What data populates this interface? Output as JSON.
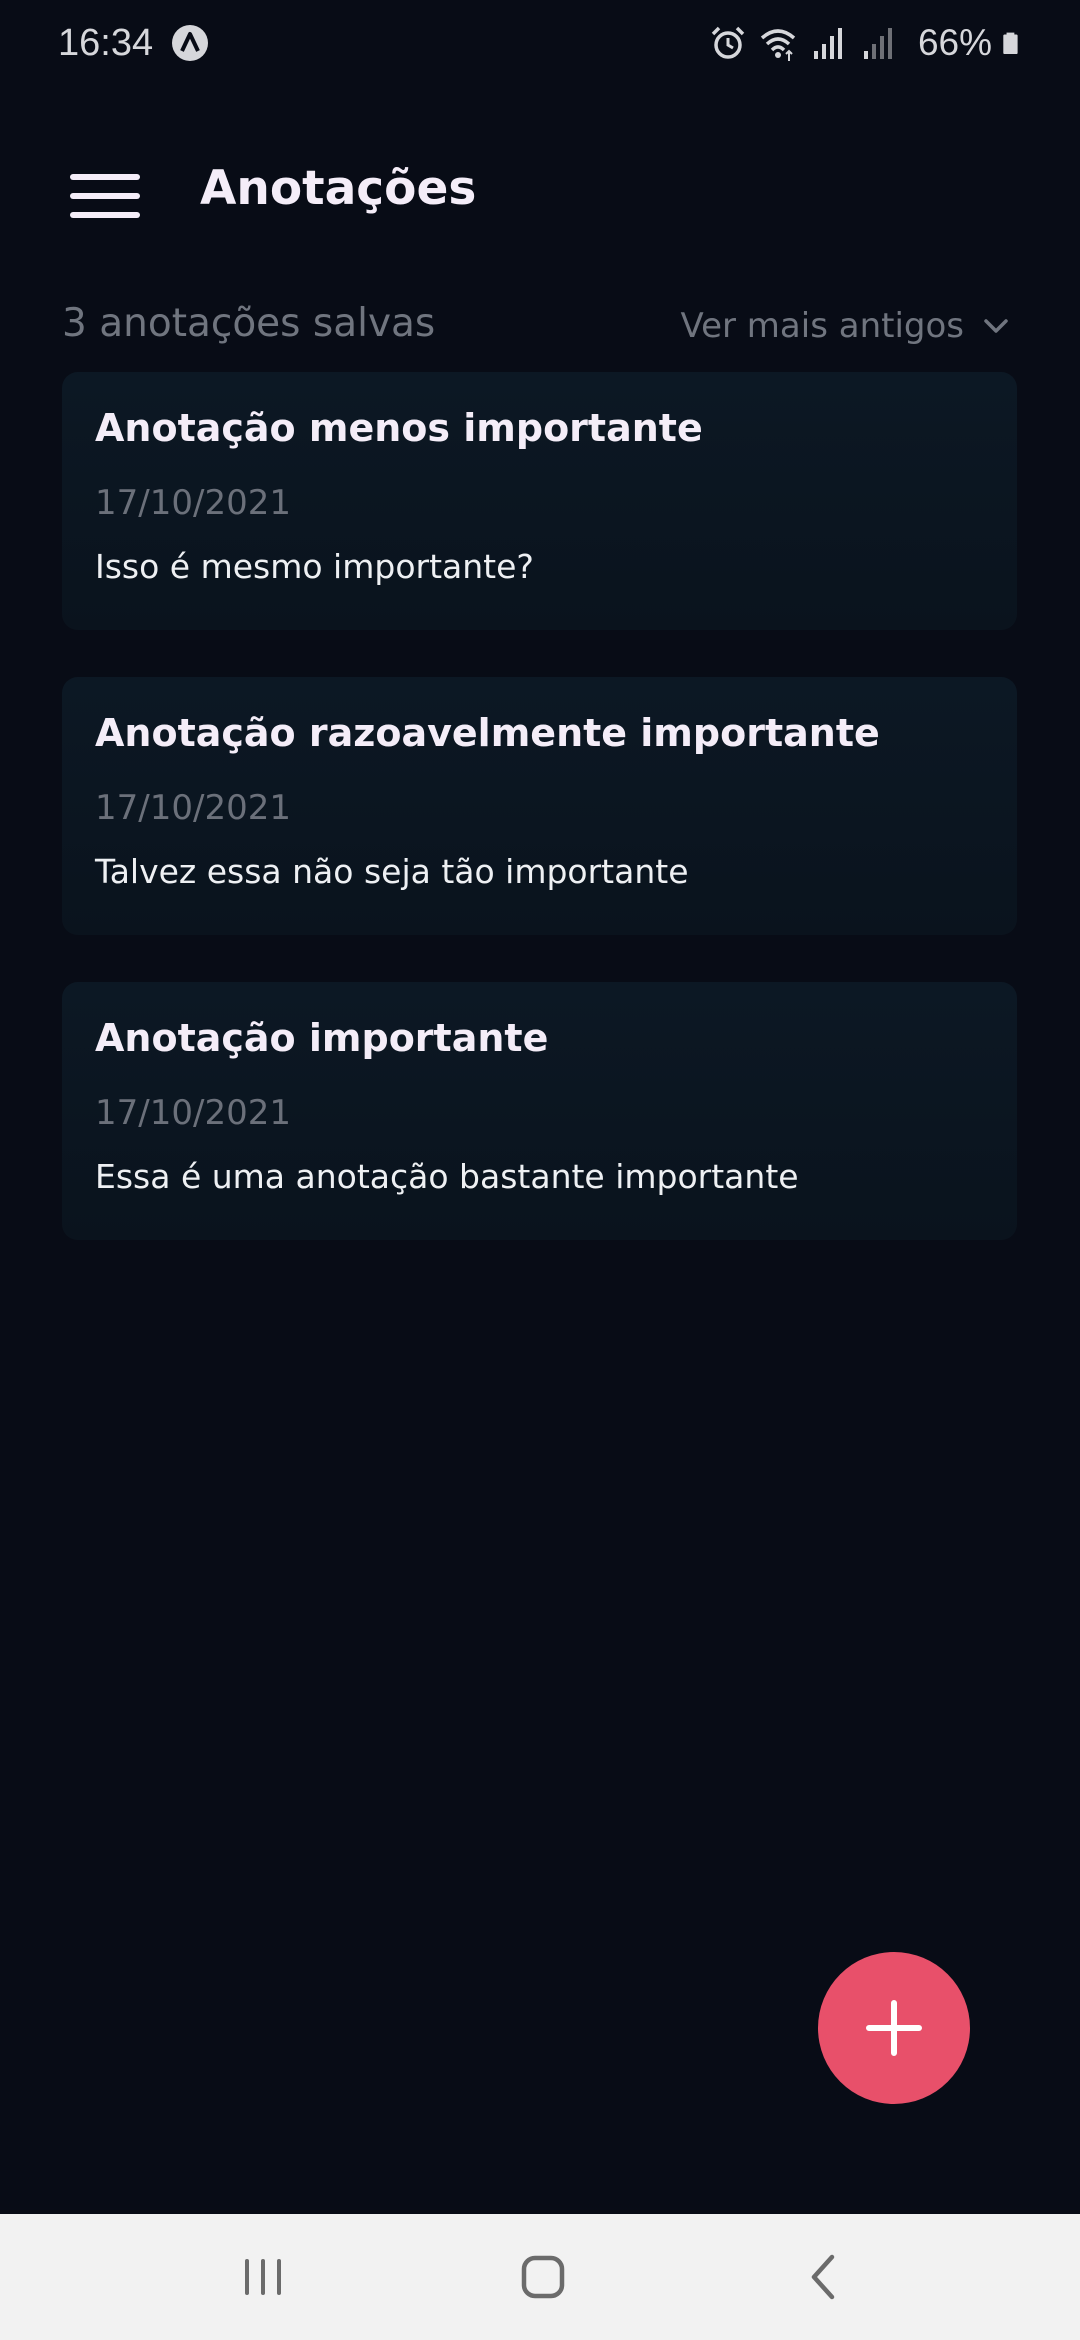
{
  "status_bar": {
    "time": "16:34",
    "battery": "66%",
    "icons": [
      "app-notification-icon",
      "alarm-icon",
      "wifi-icon",
      "signal-icon",
      "signal-weak-icon",
      "battery-icon"
    ]
  },
  "header": {
    "title": "Anotações",
    "menu_icon": "hamburger-menu-icon"
  },
  "subheader": {
    "count_label": "3 anotações salvas",
    "sort_label": "Ver mais antigos",
    "sort_icon": "chevron-down-icon"
  },
  "notes": [
    {
      "title": "Anotação menos importante",
      "date": "17/10/2021",
      "body": "Isso é mesmo importante?"
    },
    {
      "title": "Anotação razoavelmente importante",
      "date": "17/10/2021",
      "body": "Talvez essa não seja tão importante"
    },
    {
      "title": "Anotação importante",
      "date": "17/10/2021",
      "body": "Essa é uma anotação bastante importante"
    }
  ],
  "fab": {
    "icon": "plus-icon",
    "color": "#e8506a"
  },
  "nav_bar": {
    "icons": [
      "recent-apps-icon",
      "home-icon",
      "back-icon"
    ]
  },
  "colors": {
    "background": "#080c16",
    "card": "#0c1824",
    "accent": "#e8506a",
    "title_text": "#f4edf8",
    "muted_text": "#70757f"
  }
}
